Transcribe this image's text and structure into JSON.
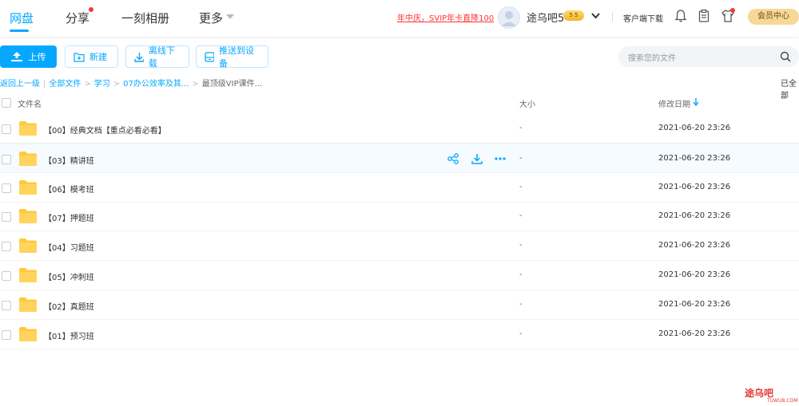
{
  "nav": {
    "items": [
      {
        "label": "网盘"
      },
      {
        "label": "分享"
      },
      {
        "label": "一刻相册"
      },
      {
        "label": "更多"
      }
    ]
  },
  "header": {
    "promo": "年中庆，SVIP年卡直降100",
    "username": "途乌吧5",
    "vip_level": "5",
    "client_download": "客户端下载",
    "member_center": "会员中心"
  },
  "toolbar": {
    "upload": "上传",
    "new": "新建",
    "offline_download": "离线下载",
    "push_to_device": "推送到设备"
  },
  "search": {
    "placeholder": "搜索您的文件"
  },
  "breadcrumb": {
    "back": "返回上一级",
    "all_files": "全部文件",
    "level1": "学习",
    "level2": "07办公效率及其...",
    "current": "最顶级VIP课件...",
    "loaded": "已全部"
  },
  "table": {
    "headers": {
      "name": "文件名",
      "size": "大小",
      "modified": "修改日期"
    },
    "rows": [
      {
        "name": "【00】经典文档【重点必看必看】",
        "size": "-",
        "date": "2021-06-20 23:26"
      },
      {
        "name": "【03】精讲班",
        "size": "-",
        "date": "2021-06-20 23:26"
      },
      {
        "name": "【06】模考班",
        "size": "-",
        "date": "2021-06-20 23:26"
      },
      {
        "name": "【07】押题班",
        "size": "-",
        "date": "2021-06-20 23:26"
      },
      {
        "name": "【04】习题班",
        "size": "-",
        "date": "2021-06-20 23:26"
      },
      {
        "name": "【05】冲刺班",
        "size": "-",
        "date": "2021-06-20 23:26"
      },
      {
        "name": "【02】真题班",
        "size": "-",
        "date": "2021-06-20 23:26"
      },
      {
        "name": "【01】预习班",
        "size": "-",
        "date": "2021-06-20 23:26"
      }
    ]
  },
  "watermark": {
    "brand": "途乌吧",
    "site": "TUWUB.COM"
  },
  "colors": {
    "accent": "#06a7ff",
    "promo": "#ff3333",
    "folder": "#ffc83d",
    "member": "#f6d997"
  }
}
